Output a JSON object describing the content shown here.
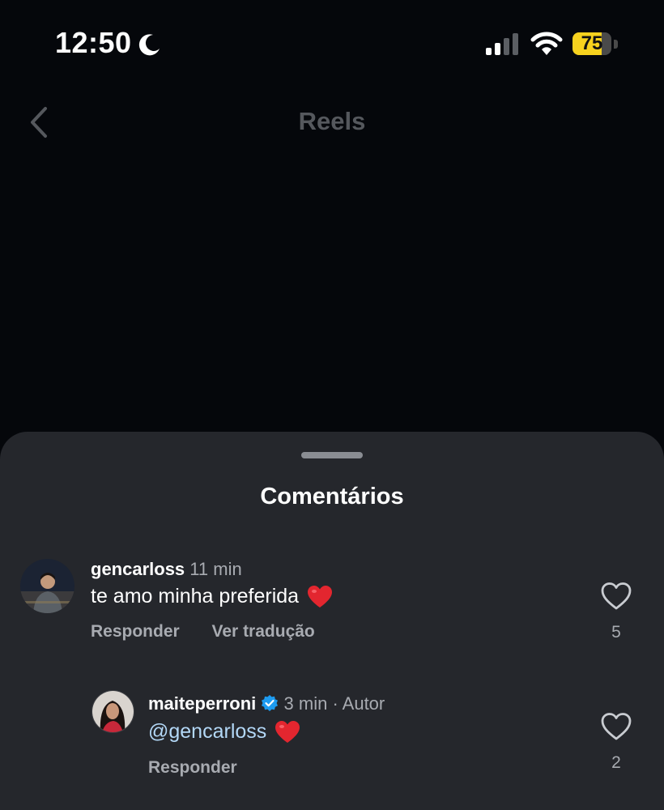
{
  "status_bar": {
    "time": "12:50",
    "battery_level": "75",
    "battery_fraction": 0.75
  },
  "nav": {
    "title": "Reels"
  },
  "comments_sheet": {
    "title": "Comentários",
    "comments": [
      {
        "username": "gencarloss",
        "time": "11 min",
        "text": "te amo minha preferida",
        "emoji": "heart",
        "reply_label": "Responder",
        "translate_label": "Ver tradução",
        "like_count": "5"
      },
      {
        "username": "maiteperroni",
        "verified": true,
        "time": "3 min",
        "author_label": "· Autor",
        "mention": "@gencarloss",
        "emoji": "heart",
        "reply_label": "Responder",
        "like_count": "2"
      }
    ]
  },
  "colors": {
    "accent_yellow": "#f7d21e",
    "verified_blue": "#1d9bf0",
    "mention": "#b3d8f7",
    "heart_red": "#e3262f"
  }
}
